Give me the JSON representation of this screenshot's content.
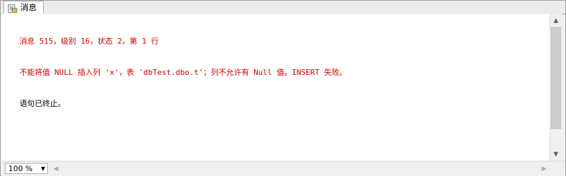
{
  "tabs": [
    {
      "label": "消息",
      "icon": "messages-icon"
    }
  ],
  "messages": {
    "lines": [
      {
        "text": "消息 515，级别 16，状态 2，第 1 行",
        "color": "#cc0000"
      },
      {
        "text": "不能将值 NULL 插入列 'x'，表 'dbTest.dbo.t'；列不允许有 Null 值。INSERT 失败。",
        "color": "#cc0000"
      },
      {
        "text": "语句已终止。",
        "color": "#000000"
      }
    ]
  },
  "zoom": {
    "value": "100 %"
  },
  "scrollbars": {
    "up_icon": "scroll-up-icon",
    "down_icon": "scroll-down-icon",
    "left_icon": "scroll-left-icon",
    "right_icon": "scroll-right-icon"
  }
}
